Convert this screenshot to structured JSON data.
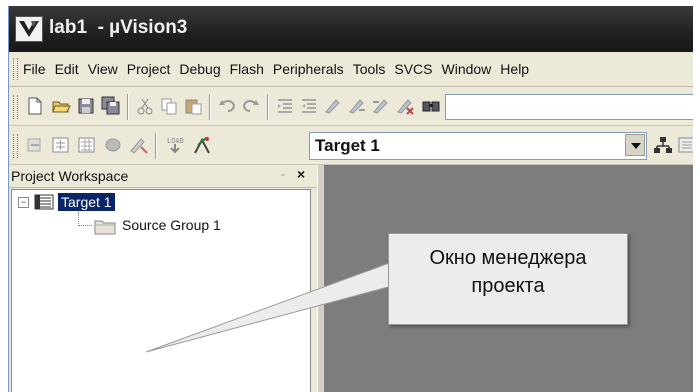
{
  "window": {
    "title": "lab1  - µVision3",
    "app_icon": "uvision-logo-icon"
  },
  "menubar": {
    "items": [
      "File",
      "Edit",
      "View",
      "Project",
      "Debug",
      "Flash",
      "Peripherals",
      "Tools",
      "SVCS",
      "Window",
      "Help"
    ]
  },
  "toolbar1": {
    "icons": [
      "new-file-icon",
      "open-folder-icon",
      "save-icon",
      "save-all-icon",
      "cut-icon",
      "copy-icon",
      "paste-icon",
      "undo-icon",
      "redo-icon",
      "indent-icon",
      "outdent-icon",
      "bookmark-icon",
      "next-bookmark-icon",
      "prev-bookmark-icon",
      "clear-bookmarks-icon",
      "find-icon"
    ],
    "find_value": ""
  },
  "toolbar2": {
    "icons": [
      "translate-icon",
      "build-icon",
      "rebuild-icon",
      "batch-build-icon",
      "stop-build-icon",
      "download-icon",
      "options-icon"
    ],
    "target_select": "Target 1",
    "extra_icons": [
      "manage-components-icon",
      "select-device-icon"
    ]
  },
  "workspace": {
    "title": "Project Workspace",
    "minimize_glyph": "-",
    "close_glyph": "×",
    "tree": {
      "expander": "−",
      "target": "Target 1",
      "group": "Source Group 1"
    }
  },
  "callout": {
    "line1": "Окно менеджера",
    "line2": "проекта"
  },
  "colors": {
    "titlebar": "#202020",
    "chrome": "#ece9d8",
    "client_area": "#7d7d7d",
    "selection": "#0a246a"
  }
}
